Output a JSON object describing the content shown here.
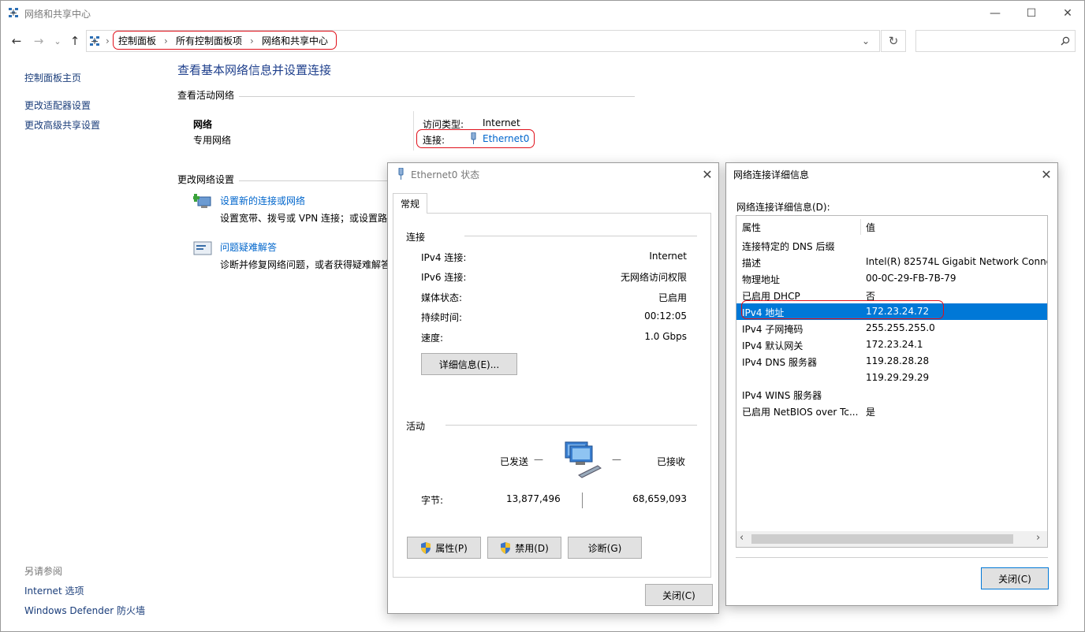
{
  "window": {
    "title": "网络和共享中心",
    "minimize": "—",
    "maximize": "☐",
    "close": "✕"
  },
  "nav": {
    "back": "←",
    "forward": "→",
    "recent": "⌄",
    "up": "↑",
    "refresh": "↻",
    "dropdown": "⌄"
  },
  "breadcrumb": {
    "sep": "›",
    "items": [
      "控制面板",
      "所有控制面板项",
      "网络和共享中心"
    ]
  },
  "search": {
    "placeholder": "",
    "icon": "search-icon"
  },
  "sidebar": {
    "items": [
      "控制面板主页",
      "更改适配器设置",
      "更改高级共享设置"
    ],
    "see_also_title": "另请参阅",
    "see_also": [
      "Internet 选项",
      "Windows Defender 防火墙"
    ]
  },
  "main": {
    "heading": "查看基本网络信息并设置连接",
    "active_title": "查看活动网络",
    "network_name": "网络",
    "network_type": "专用网络",
    "access_label": "访问类型:",
    "access_value": "Internet",
    "conn_label": "连接:",
    "conn_value": "Ethernet0",
    "change_title": "更改网络设置",
    "task1_title": "设置新的连接或网络",
    "task1_desc": "设置宽带、拨号或 VPN 连接；或设置路",
    "task2_title": "问题疑难解答",
    "task2_desc": "诊断并修复网络问题，或者获得疑难解答"
  },
  "status_dialog": {
    "title": "Ethernet0 状态",
    "close": "✕",
    "tab": "常规",
    "conn_group": "连接",
    "rows": [
      {
        "label": "IPv4 连接:",
        "value": "Internet"
      },
      {
        "label": "IPv6 连接:",
        "value": "无网络访问权限"
      },
      {
        "label": "媒体状态:",
        "value": "已启用"
      },
      {
        "label": "持续时间:",
        "value": "00:12:05"
      },
      {
        "label": "速度:",
        "value": "1.0 Gbps"
      }
    ],
    "details_btn": "详细信息(E)...",
    "activity_group": "活动",
    "sent_label": "已发送",
    "recv_label": "已接收",
    "dash": "—",
    "bytes_label": "字节:",
    "bytes_sent": "13,877,496",
    "bytes_recv": "68,659,093",
    "props_btn": "属性(P)",
    "disable_btn": "禁用(D)",
    "diag_btn": "诊断(G)",
    "close_btn": "关闭(C)"
  },
  "details_dialog": {
    "title": "网络连接详细信息",
    "close": "✕",
    "list_label": "网络连接详细信息(D):",
    "col_prop": "属性",
    "col_val": "值",
    "rows": [
      {
        "prop": "连接特定的 DNS 后缀",
        "val": ""
      },
      {
        "prop": "描述",
        "val": "Intel(R) 82574L Gigabit Network Connec"
      },
      {
        "prop": "物理地址",
        "val": "00-0C-29-FB-7B-79"
      },
      {
        "prop": "已启用 DHCP",
        "val": "否"
      },
      {
        "prop": "IPv4 地址",
        "val": "172.23.24.72"
      },
      {
        "prop": "IPv4 子网掩码",
        "val": "255.255.255.0"
      },
      {
        "prop": "IPv4 默认网关",
        "val": "172.23.24.1"
      },
      {
        "prop": "IPv4 DNS 服务器",
        "val": "119.28.28.28"
      },
      {
        "prop": "",
        "val": "119.29.29.29"
      },
      {
        "prop": "IPv4 WINS 服务器",
        "val": ""
      },
      {
        "prop": "已启用 NetBIOS over Tc...",
        "val": "是"
      }
    ],
    "scroll_left": "‹",
    "scroll_right": "›",
    "close_btn": "关闭(C)"
  },
  "colors": {
    "accent": "#0078d7",
    "selection": "#0078d7",
    "highlight": "#e0101a",
    "link": "#1a5fb4"
  }
}
